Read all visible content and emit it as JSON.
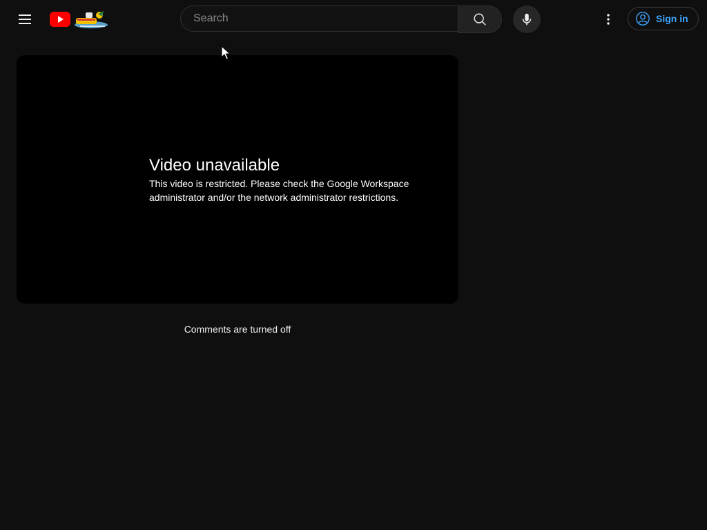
{
  "header": {
    "menu_icon": "hamburger-menu-icon",
    "logo_icon": "youtube-logo-icon",
    "doodle_icon": "doodle-icon",
    "search": {
      "placeholder": "Search",
      "value": "",
      "button_icon": "search-icon"
    },
    "mic_icon": "microphone-icon",
    "more_icon": "vertical-dots-icon",
    "sign_in": {
      "label": "Sign in",
      "icon": "account-circle-icon"
    }
  },
  "player": {
    "error_title": "Video unavailable",
    "error_message": "This video is restricted. Please check the Google Workspace administrator and/or the network administrator restrictions."
  },
  "comments": {
    "status": "Comments are turned off"
  },
  "colors": {
    "background": "#0f0f0f",
    "player_background": "#000000",
    "youtube_red": "#ff0000",
    "link_blue": "#3ea6ff"
  }
}
